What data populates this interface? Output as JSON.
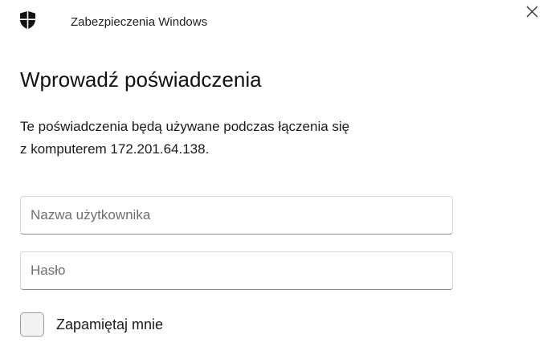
{
  "window": {
    "app_title": "Zabezpieczenia Windows",
    "app_icon": "shield-icon",
    "close_icon": "close-icon"
  },
  "dialog": {
    "heading": "Wprowadź poświadczenia",
    "description_line1": "Te poświadczenia będą używane podczas łączenia się",
    "description_line2": "z komputerem 172.201.64.138."
  },
  "form": {
    "username": {
      "value": "",
      "placeholder": "Nazwa użytkownika"
    },
    "password": {
      "value": "",
      "placeholder": "Hasło"
    },
    "remember": {
      "label": "Zapamiętaj mnie",
      "checked": false
    }
  },
  "colors": {
    "background": "#ffffff",
    "text": "#1a1a1a",
    "placeholder": "#6e6e6e",
    "field_border": "#d6d6d6",
    "field_underline": "#8a8a8a"
  }
}
